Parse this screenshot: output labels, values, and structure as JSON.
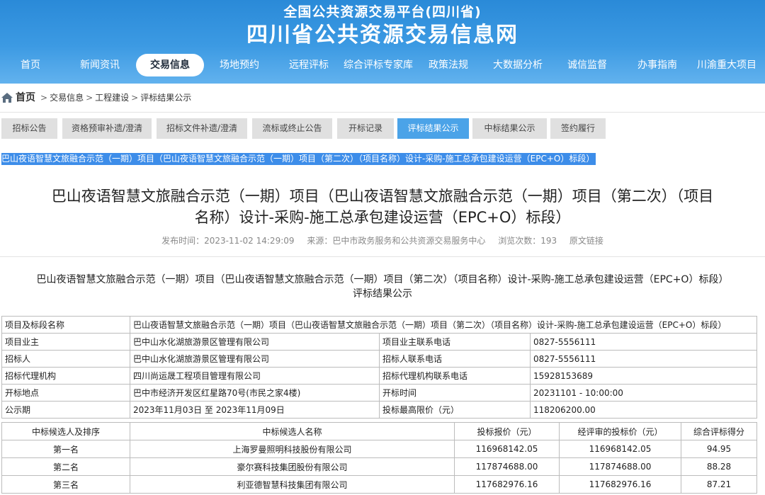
{
  "header": {
    "sub_title": "全国公共资源交易平台(四川省)",
    "main_title": "四川省公共资源交易信息网",
    "nav": [
      {
        "label": "首页"
      },
      {
        "label": "新闻资讯"
      },
      {
        "label": "交易信息",
        "active": true
      },
      {
        "label": "场地预约"
      },
      {
        "label": "远程评标"
      },
      {
        "label": "综合评标专家库"
      },
      {
        "label": "政策法规"
      },
      {
        "label": "大数据分析"
      },
      {
        "label": "诚信监督"
      },
      {
        "label": "办事指南"
      },
      {
        "label": "川渝重大项目"
      }
    ]
  },
  "breadcrumb": {
    "home": "首页",
    "items": [
      "交易信息",
      "工程建设",
      "评标结果公示"
    ],
    "separator": ">"
  },
  "tabs": [
    {
      "label": "招标公告"
    },
    {
      "label": "资格预审补遗/澄清"
    },
    {
      "label": "招标文件补遗/澄清"
    },
    {
      "label": "流标或终止公告"
    },
    {
      "label": "开标记录"
    },
    {
      "label": "评标结果公示",
      "active": true
    },
    {
      "label": "中标结果公示"
    },
    {
      "label": "签约履行"
    }
  ],
  "selected_line": "巴山夜语智慧文旅融合示范（一期）项目（巴山夜语智慧文旅融合示范（一期）项目（第二次）（项目名称）设计-采购-施工总承包建设运营（EPC+O）标段）",
  "article": {
    "title_line1": "巴山夜语智慧文旅融合示范（一期）项目（巴山夜语智慧文旅融合示范（一期）项目（第二次）（项目",
    "title_line2": "名称）设计-采购-施工总承包建设运营（EPC+O）标段）",
    "publish_time": "发布时间：2023-11-02 14:29:09",
    "source": "来源：巴中市政务服务和公共资源交易服务中心",
    "views": "浏览次数：193",
    "original_link": "原文链接"
  },
  "doc": {
    "title_line1": "巴山夜语智慧文旅融合示范（一期）项目（巴山夜语智慧文旅融合示范（一期）项目（第二次）（项目名称）设计-采购-施工总承包建设运营（EPC+O）标段）",
    "title_line2": "评标结果公示"
  },
  "info_table": {
    "project_name_label": "项目及标段名称",
    "project_name": "巴山夜语智慧文旅融合示范（一期）项目（巴山夜语智慧文旅融合示范（一期）项目（第二次）（项目名称）设计-采购-施工总承包建设运营（EPC+O）标段）",
    "rows": [
      {
        "l1": "项目业主",
        "v1": "巴中山水化湖旅游景区管理有限公司",
        "l2": "项目业主联系电话",
        "v2": "0827-5556111"
      },
      {
        "l1": "招标人",
        "v1": "巴中山水化湖旅游景区管理有限公司",
        "l2": "招标人联系电话",
        "v2": "0827-5556111"
      },
      {
        "l1": "招标代理机构",
        "v1": "四川尚运晟工程项目管理有限公司",
        "l2": "招标代理机构联系电话",
        "v2": "15928153689"
      },
      {
        "l1": "开标地点",
        "v1": "巴中市经济开发区红星路70号(市民之家4楼)",
        "l2": "开标时间",
        "v2": "20231101 - 10:00:00"
      },
      {
        "l1": "公示期",
        "v1": "2023年11月03日 至 2023年11月09日",
        "l2": "投标最高限价（元）",
        "v2": "118206200.00"
      }
    ]
  },
  "bid_table": {
    "headers": [
      "中标候选人及排序",
      "中标候选人名称",
      "投标报价（元）",
      "经评审的投标价（元）",
      "综合评标得分"
    ],
    "rows": [
      [
        "第一名",
        "上海罗曼照明科技股份有限公司",
        "116968142.05",
        "116968142.05",
        "94.95"
      ],
      [
        "第二名",
        "豪尔赛科技集团股份有限公司",
        "117874688.00",
        "117874688.00",
        "88.28"
      ],
      [
        "第三名",
        "利亚德智慧科技集团有限公司",
        "117682976.16",
        "117682976.16",
        "87.21"
      ]
    ]
  }
}
